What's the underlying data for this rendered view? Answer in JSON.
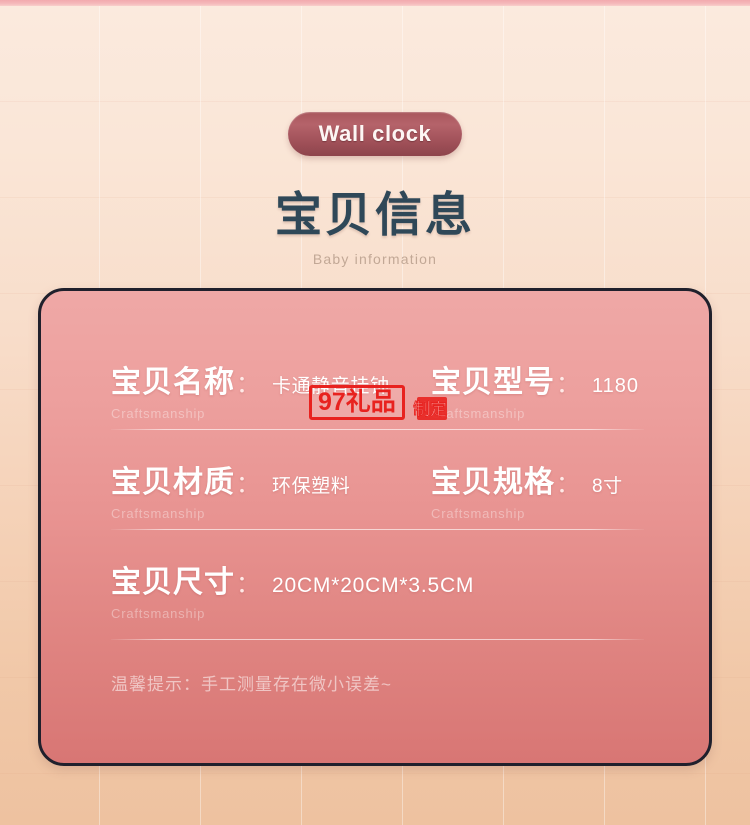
{
  "header": {
    "pill_label": "Wall clock",
    "title": "宝贝信息",
    "subtitle": "Baby information"
  },
  "card": {
    "rows": [
      {
        "left": {
          "label": "宝贝名称",
          "colon": "：",
          "value": "卡通静音挂钟",
          "sub": "Craftsmanship"
        },
        "right": {
          "label": "宝贝型号",
          "colon": "：",
          "value": "1180",
          "sub": "Craftsmanship"
        }
      },
      {
        "left": {
          "label": "宝贝材质",
          "colon": "：",
          "value": "环保塑料",
          "sub": "Craftsmanship"
        },
        "right": {
          "label": "宝贝规格",
          "colon": "：",
          "value": "8寸",
          "sub": "Craftsmanship"
        }
      },
      {
        "left": {
          "label": "宝贝尺寸",
          "colon": "：",
          "value": "20CM*20CM*3.5CM",
          "sub": "Craftsmanship"
        }
      }
    ],
    "tip": "温馨提示：手工测量存在微小误差~"
  },
  "watermark": {
    "box_text": "97礼品",
    "seal_text": "定制"
  },
  "colors": {
    "page_top": "#fbeade",
    "page_bottom": "#eec2a0",
    "top_band": "#f2a9ae",
    "pill": "#a8565c",
    "title": "#2f4858",
    "subtitle": "#c2a896",
    "card_top": "#efa8a6",
    "card_bottom": "#d87674",
    "card_border": "#20202c",
    "watermark_red": "#e8221f"
  }
}
